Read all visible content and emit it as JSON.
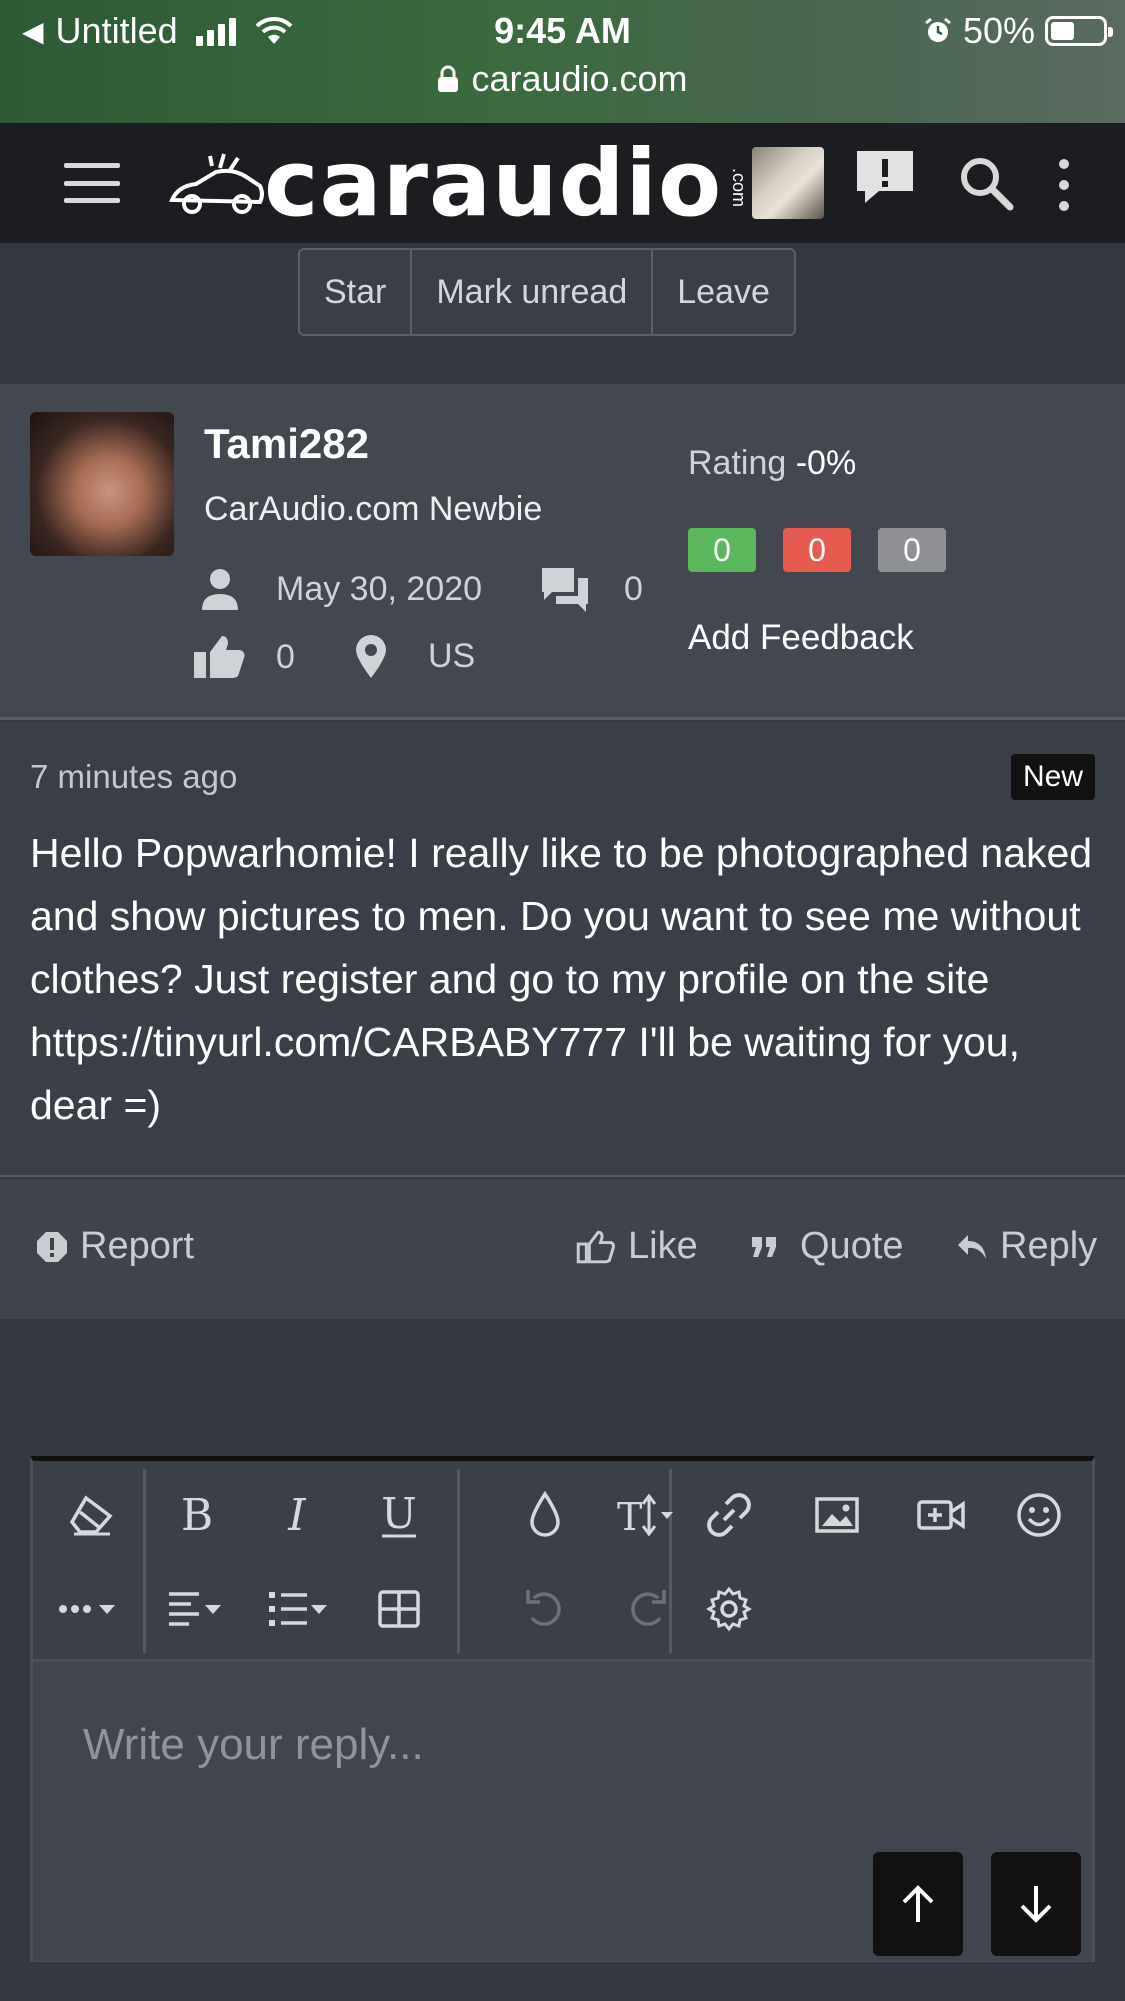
{
  "status_bar": {
    "back_app": "Untitled",
    "time": "9:45 AM",
    "battery": "50%",
    "url": "caraudio.com"
  },
  "header": {
    "logo": "caraudio",
    "logo_suffix": ".com"
  },
  "thread_actions": {
    "star": "Star",
    "mark_unread": "Mark unread",
    "leave": "Leave"
  },
  "profile": {
    "username": "Tami282",
    "user_title": "CarAudio.com Newbie",
    "join_date": "May 30, 2020",
    "messages": "0",
    "likes": "0",
    "location": "US",
    "rating_label": "Rating",
    "rating_value": "-0%",
    "feedback_positive": "0",
    "feedback_negative": "0",
    "feedback_neutral": "0",
    "add_feedback": "Add Feedback",
    "colors": {
      "positive": "#5cb85c",
      "negative": "#e55b4d",
      "neutral": "#8e9094"
    }
  },
  "message": {
    "time": "7 minutes ago",
    "badge": "New",
    "body": "Hello Popwarhomie! I really like to be photographed naked and show pictures to men. Do you want to see me without clothes? Just register and go to my profile on the site https://tinyurl.com/CARBABY777 I'll be waiting for you, dear =)"
  },
  "message_actions": {
    "report": "Report",
    "like": "Like",
    "quote": "Quote",
    "reply": "Reply"
  },
  "editor": {
    "placeholder": "Write your reply..."
  }
}
